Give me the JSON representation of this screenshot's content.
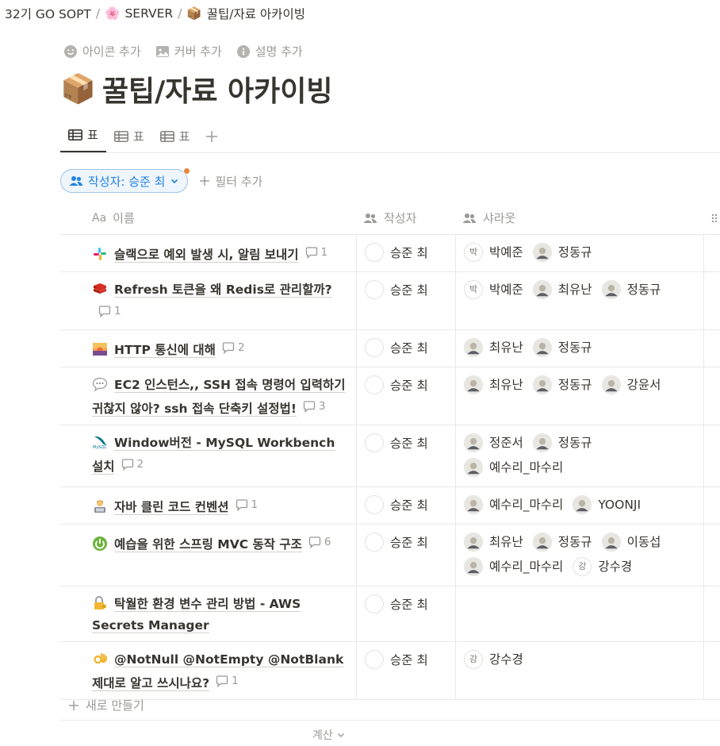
{
  "breadcrumb": {
    "items": [
      {
        "label": "32기 GO SOPT",
        "icon": ""
      },
      {
        "label": "SERVER",
        "icon": "🌸"
      },
      {
        "label": "꿀팁/자료 아카이빙",
        "icon": "📦"
      }
    ],
    "separator": "/"
  },
  "page_actions": {
    "add_icon": "아이콘 추가",
    "add_cover": "커버 추가",
    "add_description": "설명 추가"
  },
  "page": {
    "icon": "📦",
    "title": "꿀팁/자료 아카이빙"
  },
  "views": {
    "tabs": [
      {
        "label": "표",
        "active": true
      },
      {
        "label": "표",
        "active": false
      },
      {
        "label": "표",
        "active": false
      }
    ]
  },
  "filters": {
    "active_filter": "작성자: 승준 최",
    "add_filter": "필터 추가"
  },
  "table": {
    "columns": {
      "name_prefix": "Aa",
      "name": "이름",
      "author": "작성자",
      "shadow": "샤라웃"
    },
    "rows": [
      {
        "icon": "slack-logo-icon",
        "title": "슬랙으로 예외 발생 시, 알림 보내기",
        "comments": "1",
        "author": "승준 최",
        "shadow": [
          {
            "name": "박예준",
            "avatar": "박"
          },
          {
            "name": "정동규",
            "avatar": ""
          }
        ]
      },
      {
        "icon": "redis-logo-icon",
        "title": "Refresh 토큰을 왜 Redis로 관리할까?",
        "comments": "1",
        "author": "승준 최",
        "shadow": [
          {
            "name": "박예준",
            "avatar": "박"
          },
          {
            "name": "최유난",
            "avatar": ""
          },
          {
            "name": "정동규",
            "avatar": ""
          }
        ]
      },
      {
        "icon": "sunset-image-icon",
        "title": "HTTP 통신에 대해",
        "comments": "2",
        "author": "승준 최",
        "shadow": [
          {
            "name": "최유난",
            "avatar": ""
          },
          {
            "name": "정동규",
            "avatar": ""
          }
        ]
      },
      {
        "icon": "speech-bubble-icon",
        "title": "EC2 인스턴스,, SSH 접속 명령어 입력하기 귀찮지 않아? ssh 접속 단축키 설정법!",
        "comments": "3",
        "author": "승준 최",
        "shadow": [
          {
            "name": "최유난",
            "avatar": ""
          },
          {
            "name": "정동규",
            "avatar": ""
          },
          {
            "name": "강윤서",
            "avatar": ""
          }
        ]
      },
      {
        "icon": "mysql-logo-icon",
        "title": "Window버전 - MySQL Workbench 설치",
        "comments": "2",
        "author": "승준 최",
        "shadow": [
          {
            "name": "정준서",
            "avatar": ""
          },
          {
            "name": "정동규",
            "avatar": ""
          },
          {
            "name": "예수리_마수리",
            "avatar": ""
          }
        ]
      },
      {
        "icon": "technologist-icon",
        "title": "자바 클린 코드 컨벤션",
        "comments": "1",
        "author": "승준 최",
        "shadow": [
          {
            "name": "예수리_마수리",
            "avatar": ""
          },
          {
            "name": "YOONJI",
            "avatar": ""
          }
        ]
      },
      {
        "icon": "spring-logo-icon",
        "title": "예습을 위한 스프링 MVC 동작 구조",
        "comments": "6",
        "author": "승준 최",
        "shadow": [
          {
            "name": "최유난",
            "avatar": ""
          },
          {
            "name": "정동규",
            "avatar": ""
          },
          {
            "name": "이동섭",
            "avatar": ""
          },
          {
            "name": "예수리_마수리",
            "avatar": ""
          },
          {
            "name": "강수경",
            "avatar": "강"
          }
        ]
      },
      {
        "icon": "locked-with-key-icon",
        "title": "탁월한 환경 변수 관리 방법 - AWS Secrets Manager",
        "comments": "",
        "author": "승준 최",
        "shadow": []
      },
      {
        "icon": "ok-hand-icon",
        "title": "@NotNull @NotEmpty @NotBlank 제대로 알고 쓰시나요?",
        "comments": "1",
        "author": "승준 최",
        "shadow": [
          {
            "name": "강수경",
            "avatar": "강"
          }
        ]
      }
    ]
  },
  "new_row": "새로 만들기",
  "calculate": "계산",
  "colors": {
    "text": "#37352f",
    "muted": "#9b9a97",
    "accent": "#2383e2",
    "filter_bg": "#eef5fc",
    "filter_dot": "#e8843d",
    "border": "#e9e9e7"
  }
}
